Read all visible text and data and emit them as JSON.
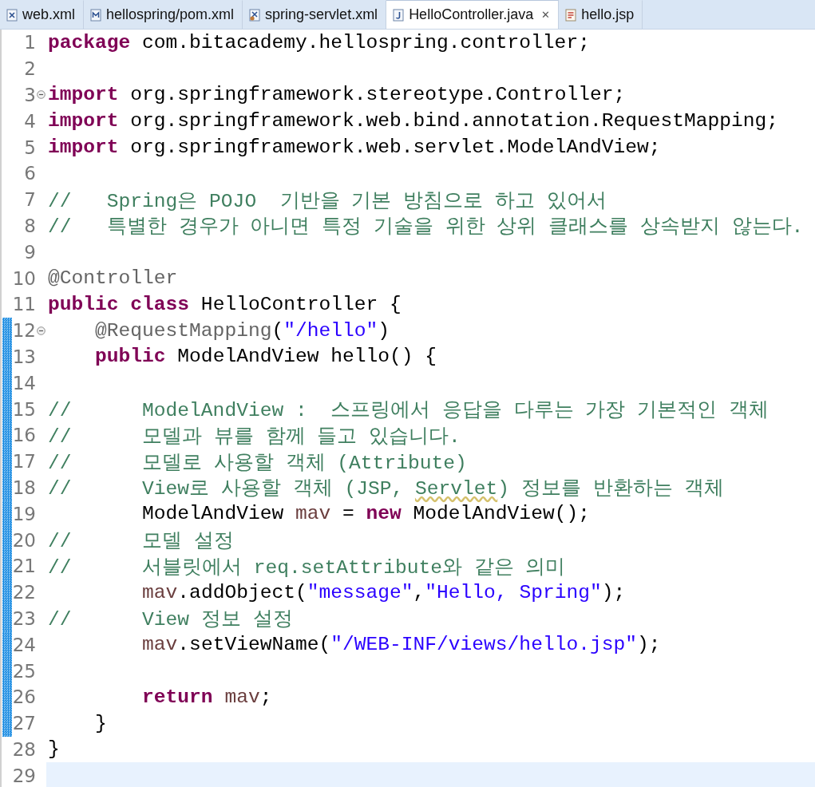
{
  "tabs": [
    {
      "label": "web.xml",
      "selected": false
    },
    {
      "label": "hellospring/pom.xml",
      "selected": false
    },
    {
      "label": "spring-servlet.xml",
      "selected": false
    },
    {
      "label": "HelloController.java",
      "selected": true,
      "close": "✕"
    },
    {
      "label": "hello.jsp",
      "selected": false
    }
  ],
  "lines": [
    {
      "number": "1",
      "tokens": [
        {
          "kind": "keyword",
          "text": "package"
        },
        {
          "kind": "plain",
          "text": " com.bitacademy.hellospring.controller;"
        }
      ]
    },
    {
      "number": "2"
    },
    {
      "number": "3",
      "fold": true,
      "tokens": [
        {
          "kind": "keyword",
          "text": "import"
        },
        {
          "kind": "plain",
          "text": " org.springframework.stereotype.Controller;"
        }
      ]
    },
    {
      "number": "4",
      "tokens": [
        {
          "kind": "keyword",
          "text": "import"
        },
        {
          "kind": "plain",
          "text": " org.springframework.web.bind.annotation.RequestMapping;"
        }
      ]
    },
    {
      "number": "5",
      "tokens": [
        {
          "kind": "keyword",
          "text": "import"
        },
        {
          "kind": "plain",
          "text": " org.springframework.web.servlet.ModelAndView;"
        }
      ]
    },
    {
      "number": "6"
    },
    {
      "number": "7",
      "tokens": [
        {
          "kind": "comment",
          "text": "//   Spring은 POJO  기반을 기본 방침으로 하고 있어서"
        }
      ]
    },
    {
      "number": "8",
      "tokens": [
        {
          "kind": "comment",
          "text": "//   특별한 경우가 아니면 특정 기술을 위한 상위 클래스를 상속받지 않는다."
        }
      ]
    },
    {
      "number": "9"
    },
    {
      "number": "10",
      "tokens": [
        {
          "kind": "annotation",
          "text": "@Controller"
        }
      ]
    },
    {
      "number": "11",
      "tokens": [
        {
          "kind": "keyword",
          "text": "public class"
        },
        {
          "kind": "plain",
          "text": " HelloController {"
        }
      ]
    },
    {
      "number": "12",
      "fold": true,
      "changed": true,
      "tokens": [
        {
          "kind": "annotation",
          "text": "    @RequestMapping"
        },
        {
          "kind": "plain",
          "text": "("
        },
        {
          "kind": "string",
          "text": "\"/hello\""
        },
        {
          "kind": "plain",
          "text": ")"
        }
      ]
    },
    {
      "number": "13",
      "changed": true,
      "tokens": [
        {
          "kind": "keyword",
          "text": "    public"
        },
        {
          "kind": "plain",
          "text": " ModelAndView hello() {"
        }
      ]
    },
    {
      "number": "14",
      "changed": true
    },
    {
      "number": "15",
      "changed": true,
      "tokens": [
        {
          "kind": "comment",
          "text": "//      ModelAndView :  스프링에서 응답을 다루는 가장 기본적인 객체"
        }
      ]
    },
    {
      "number": "16",
      "changed": true,
      "tokens": [
        {
          "kind": "comment",
          "text": "//      모델과 뷰를 함께 들고 있습니다."
        }
      ]
    },
    {
      "number": "17",
      "changed": true,
      "tokens": [
        {
          "kind": "comment",
          "text": "//      모델로 사용할 객체 (Attribute)"
        }
      ]
    },
    {
      "number": "18",
      "changed": true,
      "tokens": [
        {
          "kind": "comment",
          "text": "//      View로 사용할 객체 (JSP, "
        },
        {
          "kind": "misspelled",
          "text": "Servlet"
        },
        {
          "kind": "comment",
          "text": ") 정보를 반환하는 객체"
        }
      ]
    },
    {
      "number": "19",
      "changed": true,
      "tokens": [
        {
          "kind": "plain",
          "text": "        ModelAndView "
        },
        {
          "kind": "variable",
          "text": "mav"
        },
        {
          "kind": "plain",
          "text": " = "
        },
        {
          "kind": "keyword",
          "text": "new"
        },
        {
          "kind": "plain",
          "text": " ModelAndView();"
        }
      ]
    },
    {
      "number": "20",
      "changed": true,
      "tokens": [
        {
          "kind": "comment",
          "text": "//      모델 설정"
        }
      ]
    },
    {
      "number": "21",
      "changed": true,
      "tokens": [
        {
          "kind": "comment",
          "text": "//      서블릿에서 req.setAttribute와 같은 의미"
        }
      ]
    },
    {
      "number": "22",
      "changed": true,
      "tokens": [
        {
          "kind": "variable",
          "text": "        mav"
        },
        {
          "kind": "plain",
          "text": ".addObject("
        },
        {
          "kind": "string",
          "text": "\"message\""
        },
        {
          "kind": "plain",
          "text": ","
        },
        {
          "kind": "string",
          "text": "\"Hello, Spring\""
        },
        {
          "kind": "plain",
          "text": ");"
        }
      ]
    },
    {
      "number": "23",
      "changed": true,
      "tokens": [
        {
          "kind": "comment",
          "text": "//      View 정보 설정"
        }
      ]
    },
    {
      "number": "24",
      "changed": true,
      "tokens": [
        {
          "kind": "variable",
          "text": "        mav"
        },
        {
          "kind": "plain",
          "text": ".setViewName("
        },
        {
          "kind": "string",
          "text": "\"/WEB-INF/views/hello.jsp\""
        },
        {
          "kind": "plain",
          "text": ");"
        }
      ]
    },
    {
      "number": "25",
      "changed": true
    },
    {
      "number": "26",
      "changed": true,
      "tokens": [
        {
          "kind": "keyword",
          "text": "        return"
        },
        {
          "kind": "variable",
          "text": " mav"
        },
        {
          "kind": "plain",
          "text": ";"
        }
      ]
    },
    {
      "number": "27",
      "changed": true,
      "tokens": [
        {
          "kind": "plain",
          "text": "    }"
        }
      ]
    },
    {
      "number": "28",
      "tokens": [
        {
          "kind": "plain",
          "text": "}"
        }
      ]
    },
    {
      "number": "29",
      "current": true
    }
  ]
}
